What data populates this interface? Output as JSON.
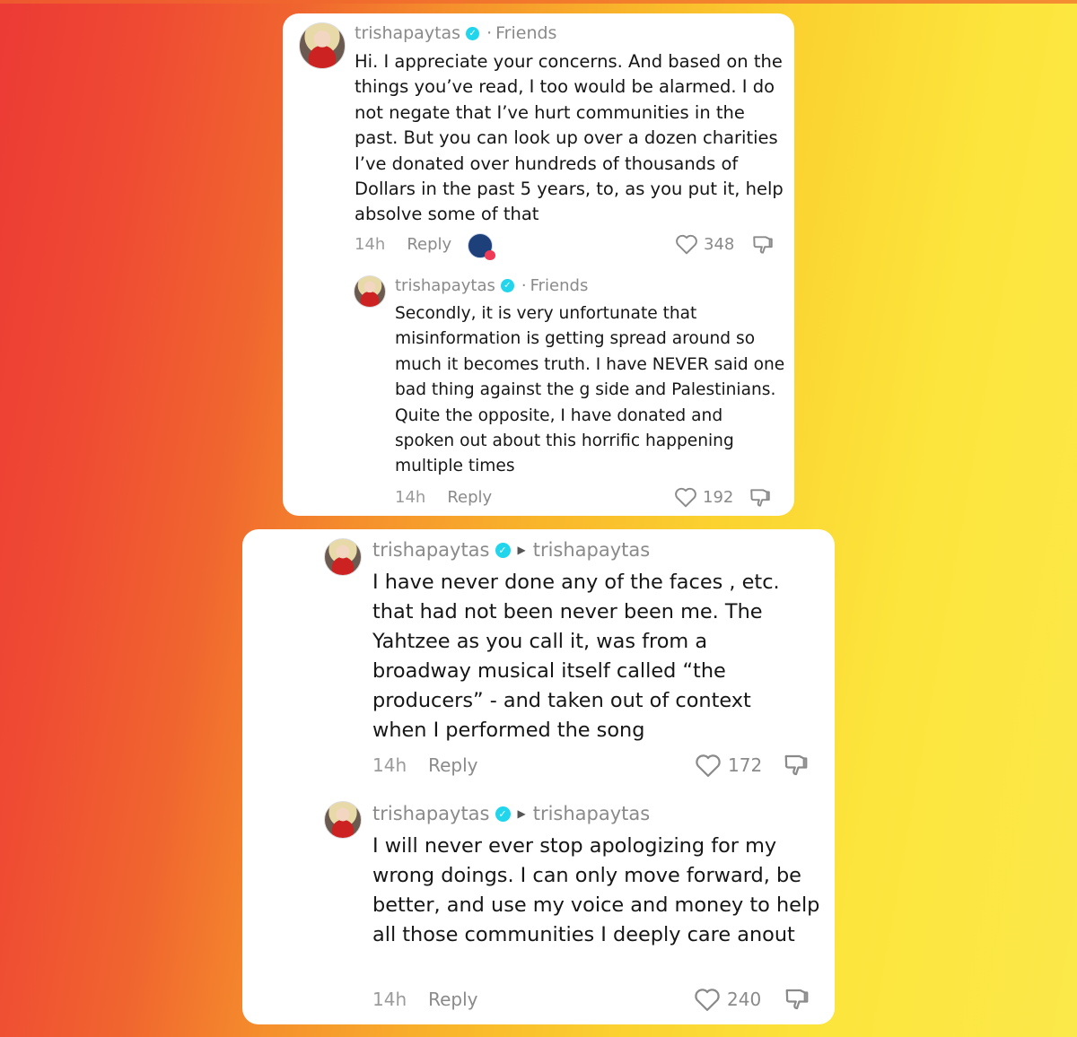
{
  "comments": [
    {
      "username": "trishapaytas",
      "context": "Friends",
      "text": "Hi. I appreciate your concerns. And based on the things you’ve read, I too would be alarmed. I do not negate that I’ve hurt communities in the past. But you can look up over a dozen charities I’ve donated over hundreds of thousands of Dollars in the past 5 years, to, as you put it, help absolve some of that",
      "time": "14h",
      "reply": "Reply",
      "likes": "348"
    },
    {
      "username": "trishapaytas",
      "context": "Friends",
      "text": "Secondly, it is very unfortunate that misinformation is getting spread around so much it becomes truth. I have NEVER said one bad thing against the g side and Palestinians. Quite the opposite, I have donated and spoken out about this horrific happening multiple times",
      "time": "14h",
      "reply": "Reply",
      "likes": "192"
    },
    {
      "username": "trishapaytas",
      "reply_to": "trishapaytas",
      "text": "I have never done any of the faces , etc. that had not been never been me. The Yahtzee as you call it, was from a broadway musical itself called “the producers” - and taken out of context when I performed the song",
      "time": "14h",
      "reply": "Reply",
      "likes": "172"
    },
    {
      "username": "trishapaytas",
      "reply_to": "trishapaytas",
      "text": "I will never ever stop apologizing for my wrong doings. I can only move forward, be better, and use my voice and money to help all those communities I deeply care anout",
      "time": "14h",
      "reply": "Reply",
      "likes": "240"
    }
  ],
  "icons": {
    "verified": "verified-check-icon",
    "like": "heart-outline-icon",
    "dislike": "thumbs-down-outline-icon",
    "reply_arrow": "caret-right-icon"
  },
  "colors": {
    "verified": "#20d5ec",
    "meta_text": "#8a8a8a",
    "body_text": "#161616",
    "card": "#ffffff"
  }
}
